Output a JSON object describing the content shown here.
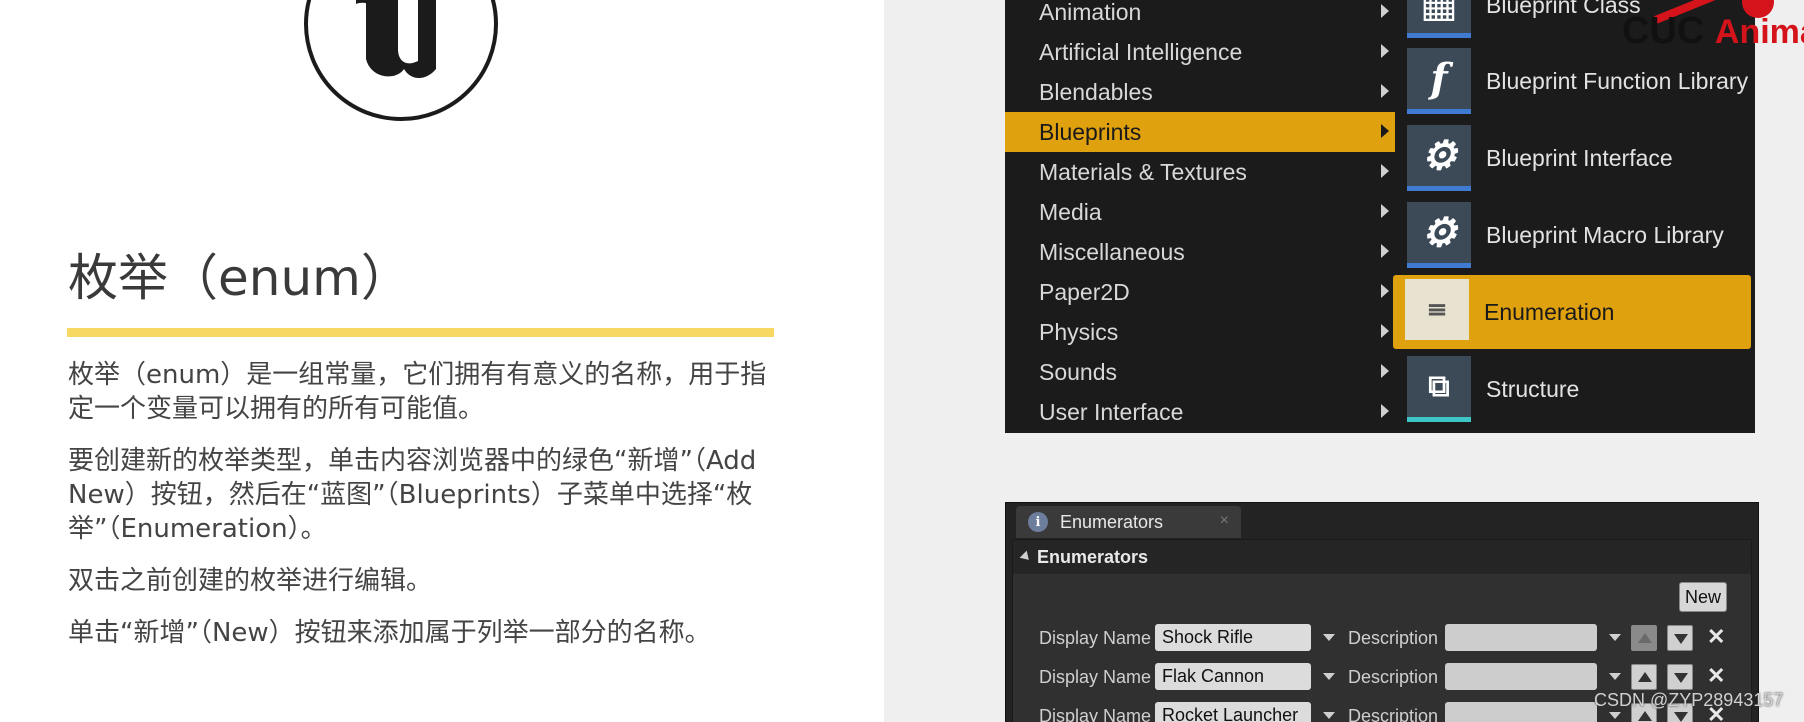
{
  "slide": {
    "title": "枚举（enum）",
    "paragraphs": [
      "枚举（enum）是一组常量，它们拥有有意义的名称，用于指定一个变量可以拥有的所有可能值。",
      "要创建新的枚举类型，单击内容浏览器中的绿色“新增”（Add New）按钮，然后在“蓝图”（Blueprints）子菜单中选择“枚举”（Enumeration）。",
      "双击之前创建的枚举进行编辑。",
      "单击“新增”（New）按钮来添加属于列举一部分的名称。"
    ]
  },
  "menu": {
    "categories": [
      {
        "label": "Animation",
        "active": false
      },
      {
        "label": "Artificial Intelligence",
        "active": false
      },
      {
        "label": "Blendables",
        "active": false
      },
      {
        "label": "Blueprints",
        "active": true
      },
      {
        "label": "Materials & Textures",
        "active": false
      },
      {
        "label": "Media",
        "active": false
      },
      {
        "label": "Miscellaneous",
        "active": false
      },
      {
        "label": "Paper2D",
        "active": false
      },
      {
        "label": "Physics",
        "active": false
      },
      {
        "label": "Sounds",
        "active": false
      },
      {
        "label": "User Interface",
        "active": false
      }
    ],
    "submenu": [
      {
        "label": "Blueprint Class",
        "icon": "blueprint-class-icon",
        "active": false
      },
      {
        "label": "Blueprint Function Library",
        "icon": "function-library-icon",
        "active": false
      },
      {
        "label": "Blueprint Interface",
        "icon": "blueprint-interface-icon",
        "active": false
      },
      {
        "label": "Blueprint Macro Library",
        "icon": "macro-library-icon",
        "active": false
      },
      {
        "label": "Enumeration",
        "icon": "enumeration-icon",
        "active": true
      },
      {
        "label": "Structure",
        "icon": "structure-icon",
        "active": false
      }
    ],
    "active_color": "#e0a10f"
  },
  "watermark": {
    "cuc_prefix": "CUC",
    "cuc_suffix": "Anima",
    "csdn": "CSDN @ZYP28943157"
  },
  "enum_editor": {
    "tab_label": "Enumerators",
    "section_label": "Enumerators",
    "new_label": "New",
    "display_name_label": "Display Name",
    "description_label": "Description",
    "rows": [
      {
        "display_name": "Shock Rifle",
        "description": ""
      },
      {
        "display_name": "Flak Cannon",
        "description": ""
      },
      {
        "display_name": "Rocket Launcher",
        "description": ""
      }
    ]
  }
}
